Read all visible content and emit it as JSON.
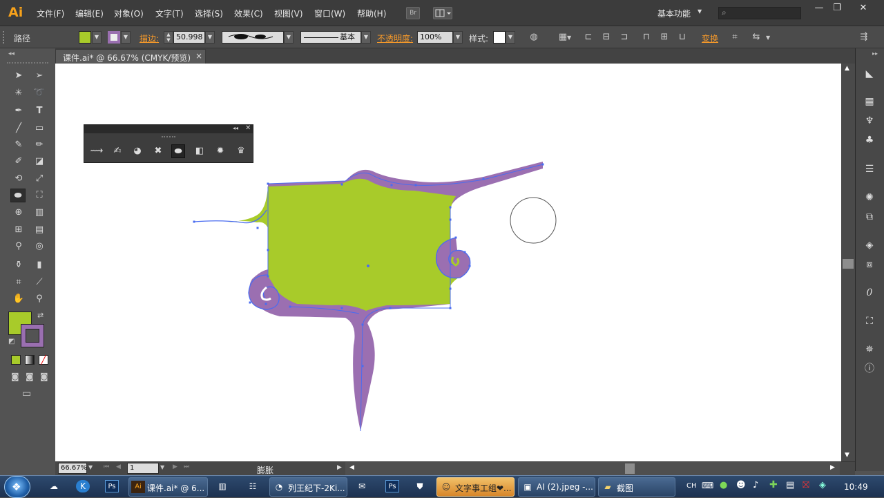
{
  "app": {
    "logo": "Ai"
  },
  "menu": [
    "文件(F)",
    "编辑(E)",
    "对象(O)",
    "文字(T)",
    "选择(S)",
    "效果(C)",
    "视图(V)",
    "窗口(W)",
    "帮助(H)"
  ],
  "bridge_button": "Br",
  "workspace": "基本功能",
  "window_controls": {
    "minimize": "—",
    "restore": "❐",
    "close": "✕"
  },
  "control_bar": {
    "object_type": "路径",
    "fill_color": "#a8cb2a",
    "stroke_color": "#9a6fb0",
    "stroke_label": "描边:",
    "stroke_weight": "50.998",
    "brush_label": "基本",
    "opacity_label": "不透明度:",
    "opacity_value": "100%",
    "style_label": "样式:",
    "transform_label": "变换"
  },
  "document_tab": {
    "title": "课件.ai* @ 66.67% (CMYK/预览)",
    "close": "×"
  },
  "canvas": {
    "fill": "#a8cb2a",
    "stroke_band": "#9b6fb1",
    "anchor_color": "#4a6cf0"
  },
  "fill_swatch": "#a8cb2a",
  "stroke_swatch": "#9a6fb0",
  "status": {
    "zoom": "66.67%",
    "page": "1",
    "tool": "膨胀"
  },
  "taskbar": {
    "items": [
      "课件.ai* @ 6...",
      "列王纪下-2Ki...",
      "文字事工组❤...",
      "AI (2).jpeg -...",
      "截图"
    ],
    "input_method": "CH",
    "time": "10:49"
  }
}
